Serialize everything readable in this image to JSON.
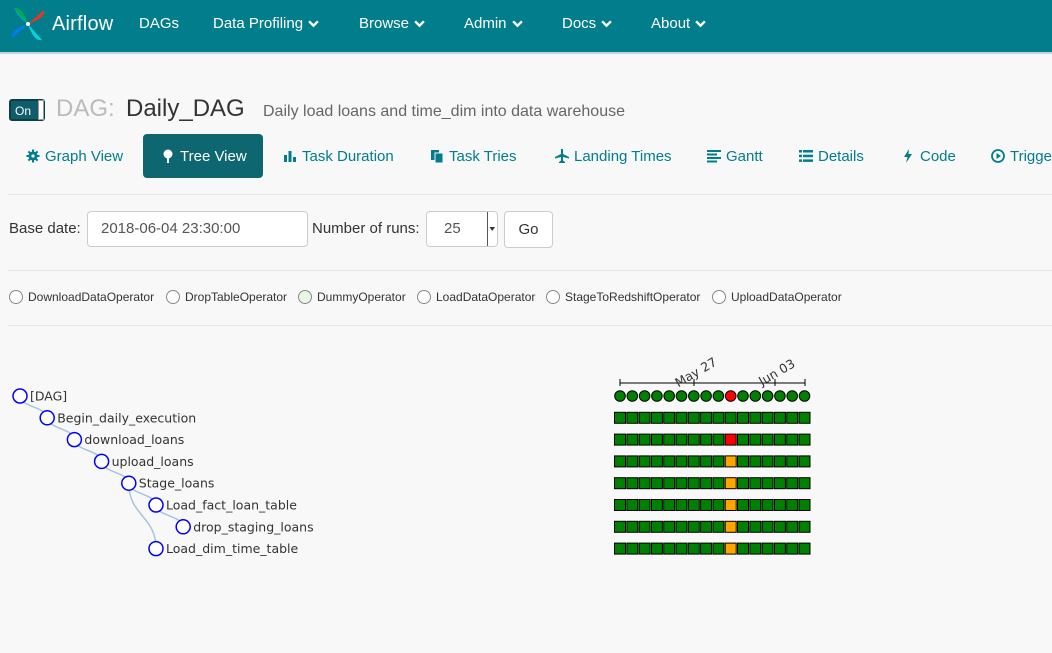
{
  "navbar": {
    "brand": "Airflow",
    "items": [
      {
        "label": "DAGs",
        "dropdown": false
      },
      {
        "label": "Data Profiling",
        "dropdown": true
      },
      {
        "label": "Browse",
        "dropdown": true
      },
      {
        "label": "Admin",
        "dropdown": true
      },
      {
        "label": "Docs",
        "dropdown": true
      },
      {
        "label": "About",
        "dropdown": true
      }
    ]
  },
  "dag": {
    "toggle_label": "On",
    "prefix": "DAG:",
    "name": "Daily_DAG",
    "description": "Daily load loans and time_dim into data warehouse"
  },
  "tabs": [
    {
      "label": "Graph View",
      "icon": "gear-icon"
    },
    {
      "label": "Tree View",
      "icon": "tree-icon",
      "active": true
    },
    {
      "label": "Task Duration",
      "icon": "bar-chart-icon"
    },
    {
      "label": "Task Tries",
      "icon": "file-icon"
    },
    {
      "label": "Landing Times",
      "icon": "plane-icon"
    },
    {
      "label": "Gantt",
      "icon": "align-left-icon"
    },
    {
      "label": "Details",
      "icon": "list-icon"
    },
    {
      "label": "Code",
      "icon": "flash-icon"
    },
    {
      "label": "Trigger DAG",
      "icon": "play-circle-icon"
    }
  ],
  "form": {
    "base_date_label": "Base date:",
    "base_date_value": "2018-06-04 23:30:00",
    "num_runs_label": "Number of runs:",
    "num_runs_value": "25",
    "go_label": "Go"
  },
  "legend": [
    {
      "label": "DownloadDataOperator",
      "color": "#ffffff"
    },
    {
      "label": "DropTableOperator",
      "color": "#ffffff"
    },
    {
      "label": "DummyOperator",
      "color": "#e8f7e4"
    },
    {
      "label": "LoadDataOperator",
      "color": "#ffffff"
    },
    {
      "label": "StageToRedshiftOperator",
      "color": "#ffffff"
    },
    {
      "label": "UploadDataOperator",
      "color": "#ffffff"
    }
  ],
  "tree": {
    "date_ticks": [
      "May 27",
      "Jun 03"
    ],
    "colors": {
      "success": "#008000",
      "failed": "#ff0000",
      "upstream_failed": "#ffa500"
    },
    "runs": 16,
    "nodes": [
      {
        "label": "[DAG]",
        "depth": 0,
        "parent": null,
        "dag_row": true,
        "states": [
          "s",
          "s",
          "s",
          "s",
          "s",
          "s",
          "s",
          "s",
          "s",
          "f",
          "s",
          "s",
          "s",
          "s",
          "s",
          "s"
        ]
      },
      {
        "label": "Begin_daily_execution",
        "depth": 1,
        "parent": 0,
        "states": [
          "s",
          "s",
          "s",
          "s",
          "s",
          "s",
          "s",
          "s",
          "s",
          "s",
          "s",
          "s",
          "s",
          "s",
          "s",
          "s"
        ]
      },
      {
        "label": "download_loans",
        "depth": 2,
        "parent": 1,
        "states": [
          "s",
          "s",
          "s",
          "s",
          "s",
          "s",
          "s",
          "s",
          "s",
          "f",
          "s",
          "s",
          "s",
          "s",
          "s",
          "s"
        ]
      },
      {
        "label": "upload_loans",
        "depth": 3,
        "parent": 2,
        "states": [
          "s",
          "s",
          "s",
          "s",
          "s",
          "s",
          "s",
          "s",
          "s",
          "u",
          "s",
          "s",
          "s",
          "s",
          "s",
          "s"
        ]
      },
      {
        "label": "Stage_loans",
        "depth": 4,
        "parent": 3,
        "states": [
          "s",
          "s",
          "s",
          "s",
          "s",
          "s",
          "s",
          "s",
          "s",
          "u",
          "s",
          "s",
          "s",
          "s",
          "s",
          "s"
        ]
      },
      {
        "label": "Load_fact_loan_table",
        "depth": 5,
        "parent": 4,
        "states": [
          "s",
          "s",
          "s",
          "s",
          "s",
          "s",
          "s",
          "s",
          "s",
          "u",
          "s",
          "s",
          "s",
          "s",
          "s",
          "s"
        ]
      },
      {
        "label": "drop_staging_loans",
        "depth": 6,
        "parent": 5,
        "states": [
          "s",
          "s",
          "s",
          "s",
          "s",
          "s",
          "s",
          "s",
          "s",
          "u",
          "s",
          "s",
          "s",
          "s",
          "s",
          "s"
        ]
      },
      {
        "label": "Load_dim_time_table",
        "depth": 5,
        "parent": 4,
        "states": [
          "s",
          "s",
          "s",
          "s",
          "s",
          "s",
          "s",
          "s",
          "s",
          "u",
          "s",
          "s",
          "s",
          "s",
          "s",
          "s"
        ]
      }
    ]
  }
}
